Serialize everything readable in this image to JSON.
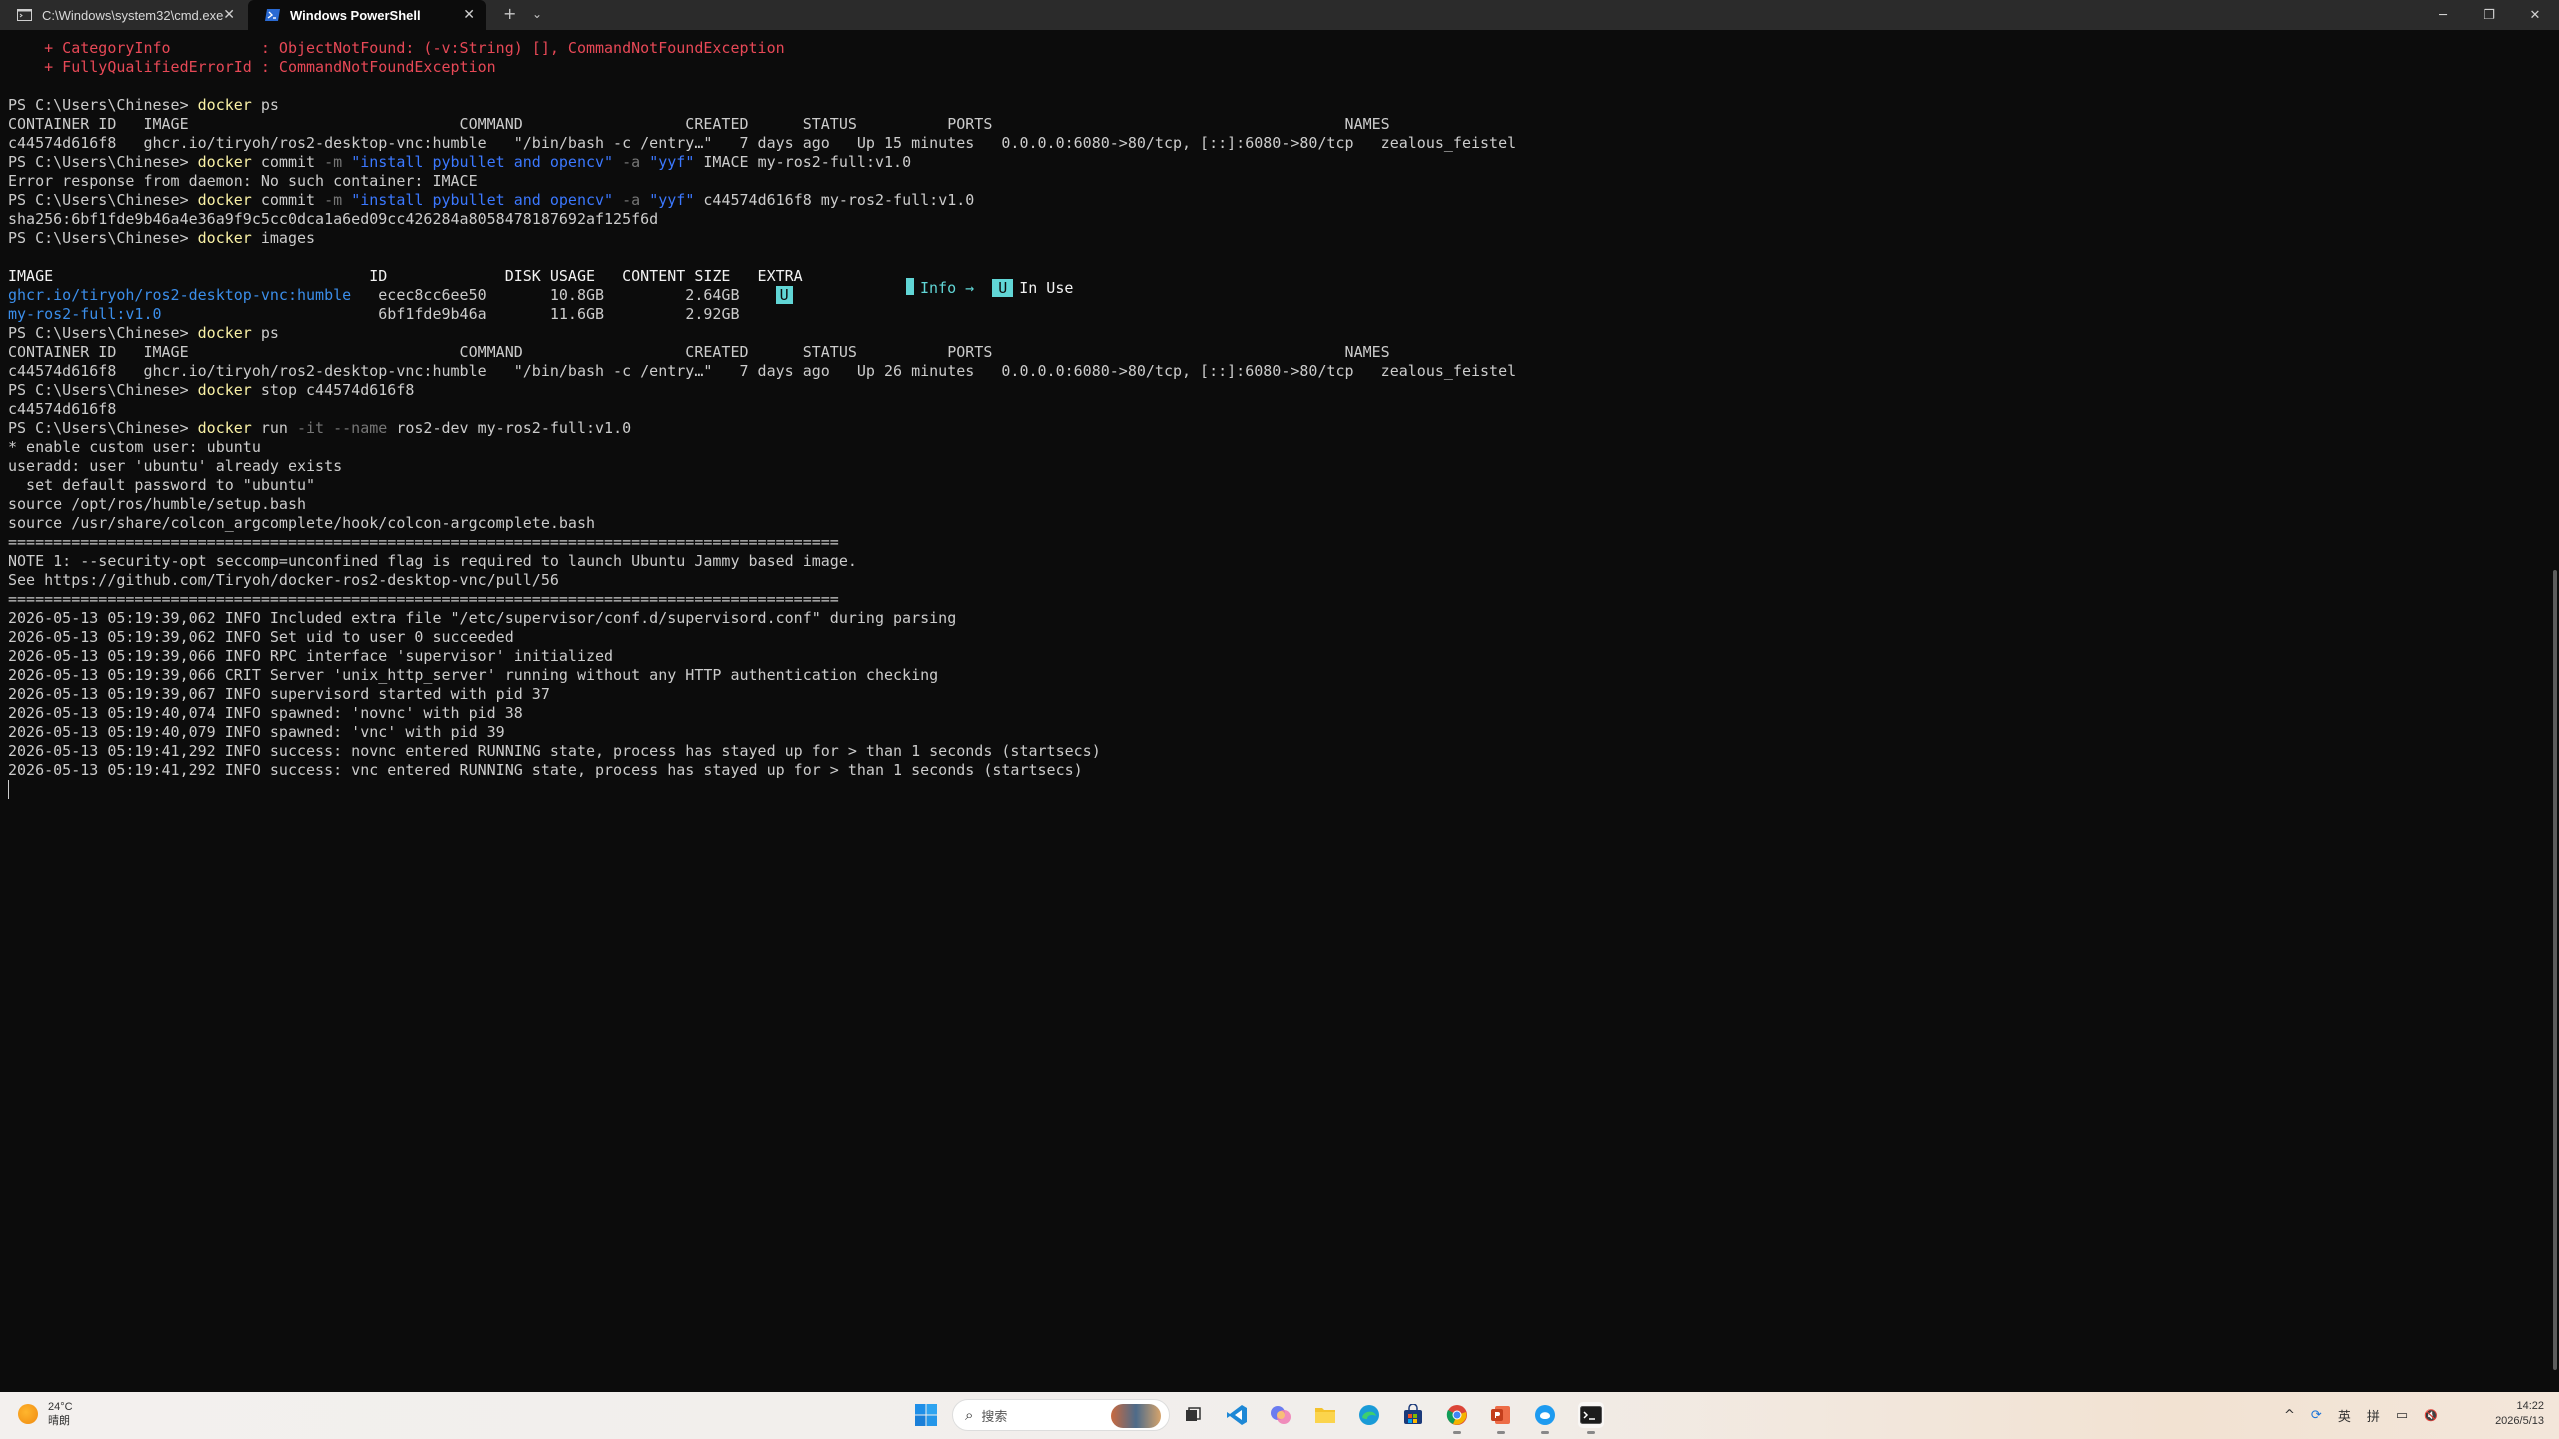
{
  "tabs": [
    {
      "label": "C:\\Windows\\system32\\cmd.exe",
      "close": "✕"
    },
    {
      "label": "Windows PowerShell",
      "close": "✕"
    }
  ],
  "tabbar": {
    "new_tab": "+",
    "dropdown": "⌄"
  },
  "window_controls": {
    "minimize": "─",
    "maximize": "❐",
    "close": "✕"
  },
  "terminal": {
    "lines": [
      [
        {
          "t": "    + CategoryInfo          : ObjectNotFound: (-v:String) [], CommandNotFoundException",
          "c": "r"
        }
      ],
      [
        {
          "t": "    + FullyQualifiedErrorId : CommandNotFoundException",
          "c": "r"
        }
      ],
      [],
      [
        {
          "t": "PS C:\\Users\\Chinese> "
        },
        {
          "t": "docker",
          "c": "y"
        },
        {
          "t": " ps"
        }
      ],
      [
        {
          "t": "CONTAINER ID   IMAGE                              COMMAND                  CREATED      STATUS          PORTS                                       NAMES"
        }
      ],
      [
        {
          "t": "c44574d616f8   ghcr.io/tiryoh/ros2-desktop-vnc:humble   \"/bin/bash -c /entry…\"   7 days ago   Up 15 minutes   0.0.0.0:6080->80/tcp, [::]:6080->80/tcp   zealous_feistel"
        }
      ],
      [
        {
          "t": "PS C:\\Users\\Chinese> "
        },
        {
          "t": "docker",
          "c": "y"
        },
        {
          "t": " commit "
        },
        {
          "t": "-m",
          "c": "g"
        },
        {
          "t": " "
        },
        {
          "t": "\"install pybullet and opencv\"",
          "c": "b"
        },
        {
          "t": " "
        },
        {
          "t": "-a",
          "c": "g"
        },
        {
          "t": " "
        },
        {
          "t": "\"yyf\"",
          "c": "b"
        },
        {
          "t": " IMACE my-ros2-full:v1.0"
        }
      ],
      [
        {
          "t": "Error response from daemon: No such container: IMACE"
        }
      ],
      [
        {
          "t": "PS C:\\Users\\Chinese> "
        },
        {
          "t": "docker",
          "c": "y"
        },
        {
          "t": " commit "
        },
        {
          "t": "-m",
          "c": "g"
        },
        {
          "t": " "
        },
        {
          "t": "\"install pybullet and opencv\"",
          "c": "b"
        },
        {
          "t": " "
        },
        {
          "t": "-a",
          "c": "g"
        },
        {
          "t": " "
        },
        {
          "t": "\"yyf\"",
          "c": "b"
        },
        {
          "t": " c44574d616f8 my-ros2-full:v1.0"
        }
      ],
      [
        {
          "t": "sha256:6bf1fde9b46a4e36a9f9c5cc0dca1a6ed09cc426284a8058478187692af125f6d"
        }
      ],
      [
        {
          "t": "PS C:\\Users\\Chinese> "
        },
        {
          "t": "docker",
          "c": "y"
        },
        {
          "t": " images"
        }
      ],
      [],
      [
        {
          "t": "IMAGE                                   ID             DISK USAGE   CONTENT SIZE   EXTRA",
          "c": "w"
        }
      ],
      [
        {
          "t": "ghcr.io/tiryoh/ros2-desktop-vnc:humble",
          "c": "lb"
        },
        {
          "t": "   ecec8cc6ee50       10.8GB         2.64GB    "
        },
        {
          "t": "U",
          "c": "sel"
        }
      ],
      [
        {
          "t": "my-ros2-full:v1.0",
          "c": "lb"
        },
        {
          "t": "                        6bf1fde9b46a       11.6GB         2.92GB"
        }
      ],
      [
        {
          "t": "PS C:\\Users\\Chinese> "
        },
        {
          "t": "docker",
          "c": "y"
        },
        {
          "t": " ps"
        }
      ],
      [
        {
          "t": "CONTAINER ID   IMAGE                              COMMAND                  CREATED      STATUS          PORTS                                       NAMES"
        }
      ],
      [
        {
          "t": "c44574d616f8   ghcr.io/tiryoh/ros2-desktop-vnc:humble   \"/bin/bash -c /entry…\"   7 days ago   Up 26 minutes   0.0.0.0:6080->80/tcp, [::]:6080->80/tcp   zealous_feistel"
        }
      ],
      [
        {
          "t": "PS C:\\Users\\Chinese> "
        },
        {
          "t": "docker",
          "c": "y"
        },
        {
          "t": " stop c44574d616f8"
        }
      ],
      [
        {
          "t": "c44574d616f8"
        }
      ],
      [
        {
          "t": "PS C:\\Users\\Chinese> "
        },
        {
          "t": "docker",
          "c": "y"
        },
        {
          "t": " run "
        },
        {
          "t": "-it",
          "c": "g"
        },
        {
          "t": " "
        },
        {
          "t": "--name",
          "c": "g"
        },
        {
          "t": " ros2-dev my-ros2-full:v1.0"
        }
      ],
      [
        {
          "t": "* enable custom user: ubuntu"
        }
      ],
      [
        {
          "t": "useradd: user 'ubuntu' already exists"
        }
      ],
      [
        {
          "t": "  set default password to \"ubuntu\""
        }
      ],
      [
        {
          "t": "source /opt/ros/humble/setup.bash"
        }
      ],
      [
        {
          "t": "source /usr/share/colcon_argcomplete/hook/colcon-argcomplete.bash"
        }
      ],
      [
        {
          "t": "============================================================================================"
        }
      ],
      [
        {
          "t": "NOTE 1: --security-opt seccomp=unconfined flag is required to launch Ubuntu Jammy based image."
        }
      ],
      [
        {
          "t": "See https://github.com/Tiryoh/docker-ros2-desktop-vnc/pull/56"
        }
      ],
      [
        {
          "t": "============================================================================================"
        }
      ],
      [
        {
          "t": "2026-05-13 05:19:39,062 INFO Included extra file \"/etc/supervisor/conf.d/supervisord.conf\" during parsing"
        }
      ],
      [
        {
          "t": "2026-05-13 05:19:39,062 INFO Set uid to user 0 succeeded"
        }
      ],
      [
        {
          "t": "2026-05-13 05:19:39,066 INFO RPC interface 'supervisor' initialized"
        }
      ],
      [
        {
          "t": "2026-05-13 05:19:39,066 CRIT Server 'unix_http_server' running without any HTTP authentication checking"
        }
      ],
      [
        {
          "t": "2026-05-13 05:19:39,067 INFO supervisord started with pid 37"
        }
      ],
      [
        {
          "t": "2026-05-13 05:19:40,074 INFO spawned: 'novnc' with pid 38"
        }
      ],
      [
        {
          "t": "2026-05-13 05:19:40,079 INFO spawned: 'vnc' with pid 39"
        }
      ],
      [
        {
          "t": "2026-05-13 05:19:41,292 INFO success: novnc entered RUNNING state, process has stayed up for > than 1 seconds (startsecs)"
        }
      ],
      [
        {
          "t": "2026-05-13 05:19:41,292 INFO success: vnc entered RUNNING state, process has stayed up for > than 1 seconds (startsecs)"
        }
      ],
      [
        {
          "cursor": true
        }
      ]
    ],
    "legend": {
      "info": "Info →",
      "badge": "U",
      "in_use": "In Use"
    }
  },
  "taskbar": {
    "weather_temp": "24°C",
    "weather_desc": "晴朗",
    "search_placeholder": "搜索",
    "apps": [
      "task-view-icon",
      "vscode-icon",
      "copilot-icon",
      "file-explorer-icon",
      "edge-icon",
      "store-icon",
      "chrome-icon",
      "powerpoint-icon",
      "qq-icon",
      "terminal-icon"
    ]
  },
  "tray": {
    "chevron": "^",
    "sync": "⟳",
    "ime_lang": "英",
    "ime_mode": "拼",
    "network": "▭",
    "volume": "🔇"
  },
  "clock": {
    "time": "14:22",
    "date": "2026/5/13"
  },
  "colors": {
    "error": "#e74856",
    "command": "#f9f1a5",
    "param": "#767676",
    "string": "#3b78ff",
    "link": "#3b8eea",
    "accent": "#61d6d6"
  }
}
